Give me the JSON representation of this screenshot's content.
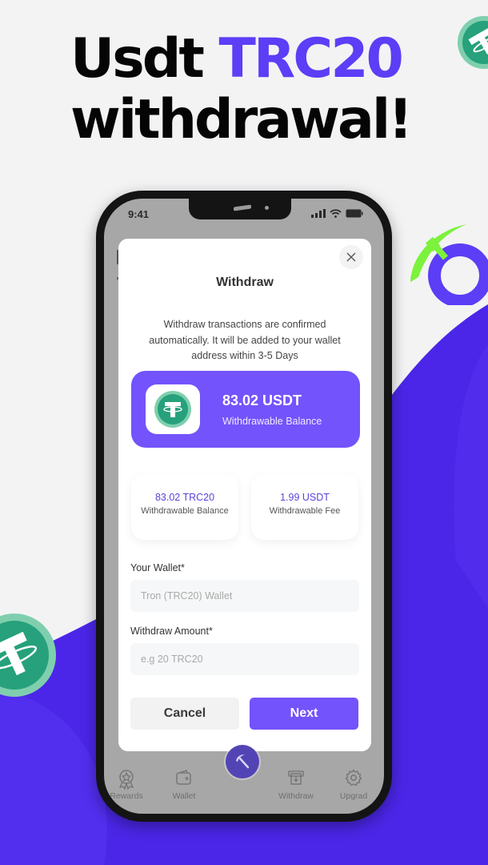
{
  "headline": {
    "line1_prefix": "Usdt ",
    "line1_accent": "TRC20",
    "line2": "withdrawal!"
  },
  "colors": {
    "accent": "#5b3ef6",
    "button_primary": "#7353fb",
    "tether_green": "#26a17b",
    "pick_green": "#7cf23c"
  },
  "status_bar": {
    "time": "9:41"
  },
  "modal": {
    "title": "Withdraw",
    "description": "Withdraw transactions are confirmed automatically. It will be added to your wallet address within 3-5 Days",
    "close_icon": "close-icon",
    "balance_card": {
      "amount": "83.02 USDT",
      "label": "Withdrawable Balance",
      "icon": "tether-icon"
    },
    "info_cards": [
      {
        "value": "83.02 TRC20",
        "label": "Withdrawable Balance"
      },
      {
        "value": "1.99 USDT",
        "label": "Withdrawable Fee"
      }
    ],
    "fields": {
      "wallet": {
        "label": "Your Wallet*",
        "placeholder": "Tron (TRC20) Wallet",
        "value": ""
      },
      "amount": {
        "label": "Withdraw Amount*",
        "placeholder": "e.g 20 TRC20",
        "value": ""
      }
    },
    "buttons": {
      "cancel": "Cancel",
      "next": "Next"
    }
  },
  "bottom_nav": {
    "center_icon": "pickaxe-icon",
    "items": [
      {
        "label": "Rewards",
        "icon": "award-icon"
      },
      {
        "label": "Wallet",
        "icon": "wallet-icon"
      },
      {
        "label": "Withdraw",
        "icon": "withdraw-icon"
      },
      {
        "label": "Upgrad",
        "icon": "gear-icon"
      }
    ]
  }
}
